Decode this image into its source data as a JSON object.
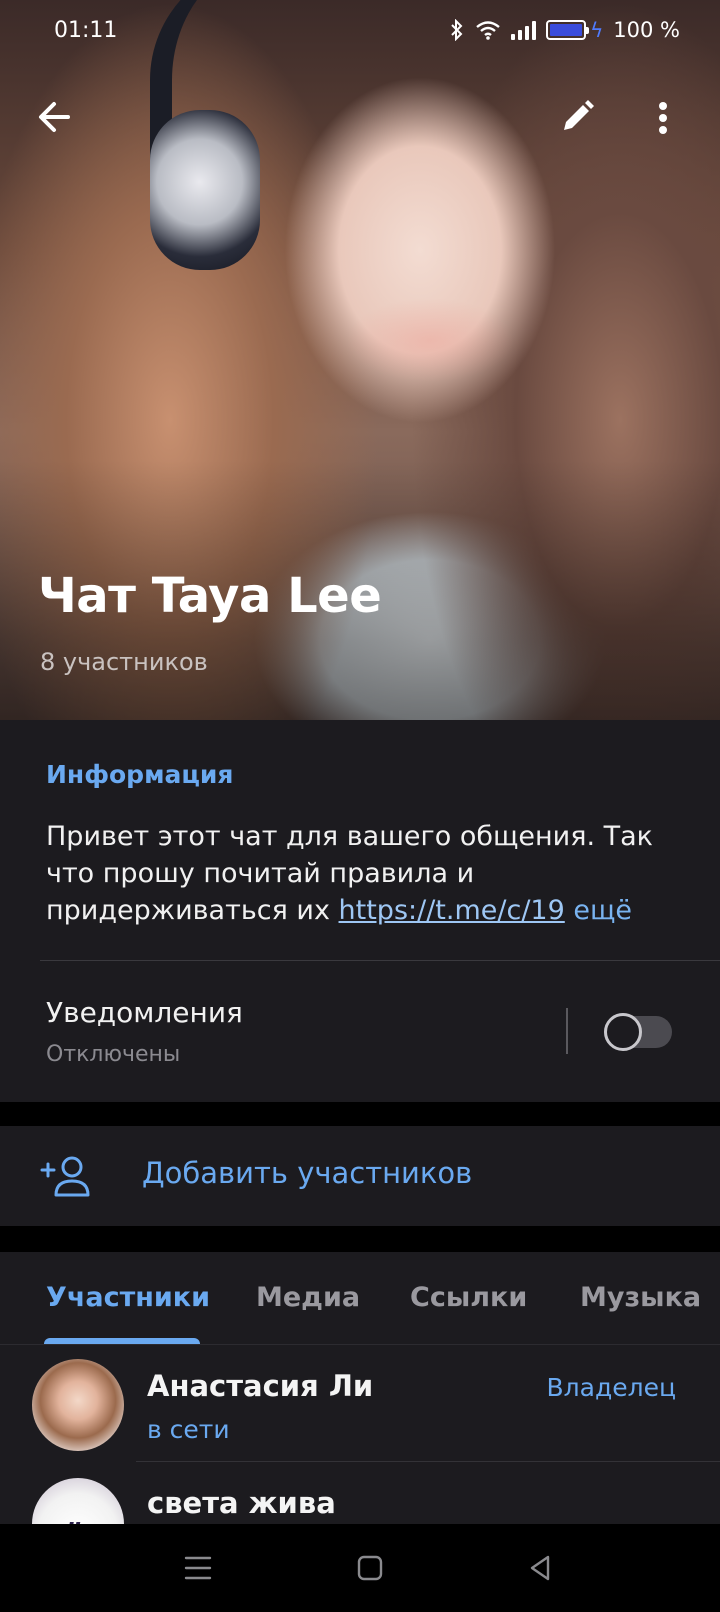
{
  "status_bar": {
    "time": "01:11",
    "battery_percent": "100 %",
    "battery_level": 1.0
  },
  "header": {
    "title": "Чат Taya Lee",
    "subtitle": "8 участников",
    "icons": [
      "back-arrow-icon",
      "pencil-icon",
      "more-vertical-icon"
    ]
  },
  "info": {
    "heading": "Информация",
    "description": "Привет этот чат для вашего общения. Так что прошу почитай правила и придерживаться их ",
    "link": "https://t.me/c/19",
    "link_fade": "",
    "more": "ещё"
  },
  "notifications": {
    "label": "Уведомления",
    "status": "Отключены",
    "enabled": false
  },
  "add_members": {
    "label": "Добавить участников",
    "icon": "add-person-icon"
  },
  "tabs": [
    {
      "label": "Участники",
      "active": true
    },
    {
      "label": "Медиа",
      "active": false
    },
    {
      "label": "Ссылки",
      "active": false
    },
    {
      "label": "Музыка",
      "active": false
    }
  ],
  "members": [
    {
      "name": "Анастасия Ли",
      "status": "в сети",
      "role": "Владелец"
    },
    {
      "name": "света жива",
      "status": "",
      "role": "",
      "avatar_text": "eclipse"
    }
  ],
  "colors": {
    "accent": "#6aa9f0",
    "card_bg": "#1c1b1f",
    "battery": "#3a4cdb"
  }
}
